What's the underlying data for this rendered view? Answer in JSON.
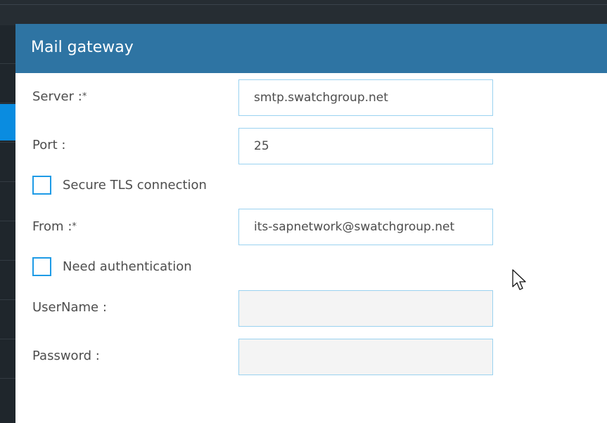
{
  "dialog": {
    "title": "Mail gateway"
  },
  "form": {
    "server": {
      "label": "Server :",
      "required_mark": "*",
      "value": "smtp.swatchgroup.net"
    },
    "port": {
      "label": "Port :",
      "value": "25"
    },
    "secure_tls": {
      "label": "Secure TLS connection",
      "checked": false
    },
    "from": {
      "label": "From :",
      "required_mark": "*",
      "value": "its-sapnetwork@swatchgroup.net"
    },
    "need_auth": {
      "label": "Need authentication",
      "checked": false
    },
    "username": {
      "label": "UserName :",
      "value": ""
    },
    "password": {
      "label": "Password :",
      "value": ""
    }
  },
  "colors": {
    "header": "#2e74a3",
    "field_border": "#9ad2f0",
    "checkbox_border": "#1e9be6",
    "sidebar_active": "#0a8ce0"
  },
  "icons": {
    "cursor": "mouse-pointer-icon"
  }
}
